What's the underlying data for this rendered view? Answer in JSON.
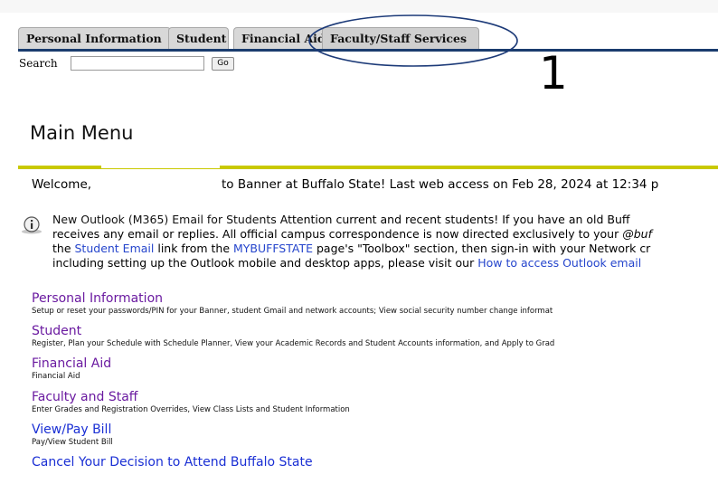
{
  "tabs": [
    {
      "label": "Personal Information"
    },
    {
      "label": "Student"
    },
    {
      "label": "Financial Aid"
    },
    {
      "label": "Faculty/Staff Services"
    }
  ],
  "search": {
    "label": "Search",
    "value": "",
    "button": "Go"
  },
  "annotation": {
    "number": "1"
  },
  "page_title": "Main Menu",
  "welcome": {
    "greeting": "Welcome,",
    "message": "to Banner at Buffalo State! Last web access on Feb 28, 2024 at 12:34 p"
  },
  "notice": {
    "icon": "info-icon",
    "heading": "New Outlook (M365) Email for Students",
    "line1": "Attention current and recent students! If you have an old Buff",
    "line2a": "receives any email or replies. All official campus correspondence is now directed exclusively to your ",
    "line2b": "@buf",
    "line3a": "the ",
    "link_student_email": "Student Email",
    "line3b": " link from the ",
    "link_mybuffstate": "MYBUFFSTATE",
    "line3c": " page's \"Toolbox\" section, then sign-in with your Network cr",
    "line4a": "including setting up the Outlook mobile and desktop apps, please visit our ",
    "link_outlook": "How to access Outlook email"
  },
  "menu": [
    {
      "title": "Personal Information",
      "desc": "Setup or reset your passwords/PIN for your Banner, student Gmail and network accounts; View social security number change informat"
    },
    {
      "title": "Student",
      "desc": "Register, Plan your Schedule with Schedule Planner, View your Academic Records and Student Accounts information, and Apply to Grad"
    },
    {
      "title": "Financial Aid",
      "desc": "Financial Aid"
    },
    {
      "title": "Faculty and Staff",
      "desc": "Enter Grades and Registration Overrides, View Class Lists and Student Information"
    },
    {
      "title": "View/Pay Bill",
      "desc": "Pay/View Student Bill"
    },
    {
      "title": "Cancel Your Decision to Attend Buffalo State",
      "desc": ""
    }
  ],
  "colors": {
    "tab_line": "#1a3c6e",
    "rule": "#c9c900",
    "visited_link": "#6a1aa0",
    "link": "#1a2fd4"
  }
}
